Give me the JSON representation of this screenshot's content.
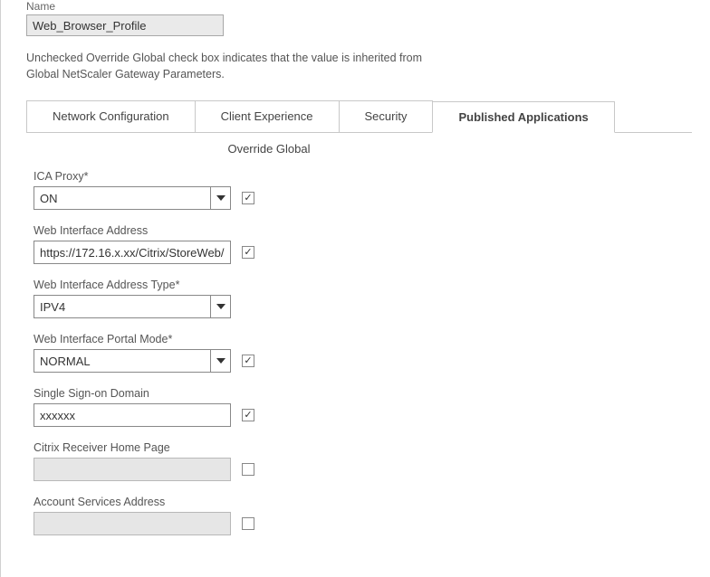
{
  "header": {
    "name_label": "Name",
    "name_value": "Web_Browser_Profile",
    "info_line1": "Unchecked Override Global check box indicates that the value is inherited from",
    "info_line2": "Global NetScaler Gateway Parameters."
  },
  "tabs": {
    "network": "Network Configuration",
    "client": "Client Experience",
    "security": "Security",
    "published": "Published Applications"
  },
  "panel": {
    "override_title": "Override Global",
    "ica_proxy": {
      "label": "ICA Proxy*",
      "value": "ON",
      "override": true
    },
    "wi_address": {
      "label": "Web Interface Address",
      "value": "https://172.16.x.xx/Citrix/StoreWeb/",
      "override": true
    },
    "wi_type": {
      "label": "Web Interface Address Type*",
      "value": "IPV4",
      "override": false
    },
    "wi_portal": {
      "label": "Web Interface Portal Mode*",
      "value": "NORMAL",
      "override": true
    },
    "sso_domain": {
      "label": "Single Sign-on Domain",
      "value": "xxxxxx",
      "override": true
    },
    "receiver_home": {
      "label": "Citrix Receiver Home Page",
      "value": "",
      "override": false
    },
    "account_services": {
      "label": "Account Services Address",
      "value": "",
      "override": false
    }
  }
}
